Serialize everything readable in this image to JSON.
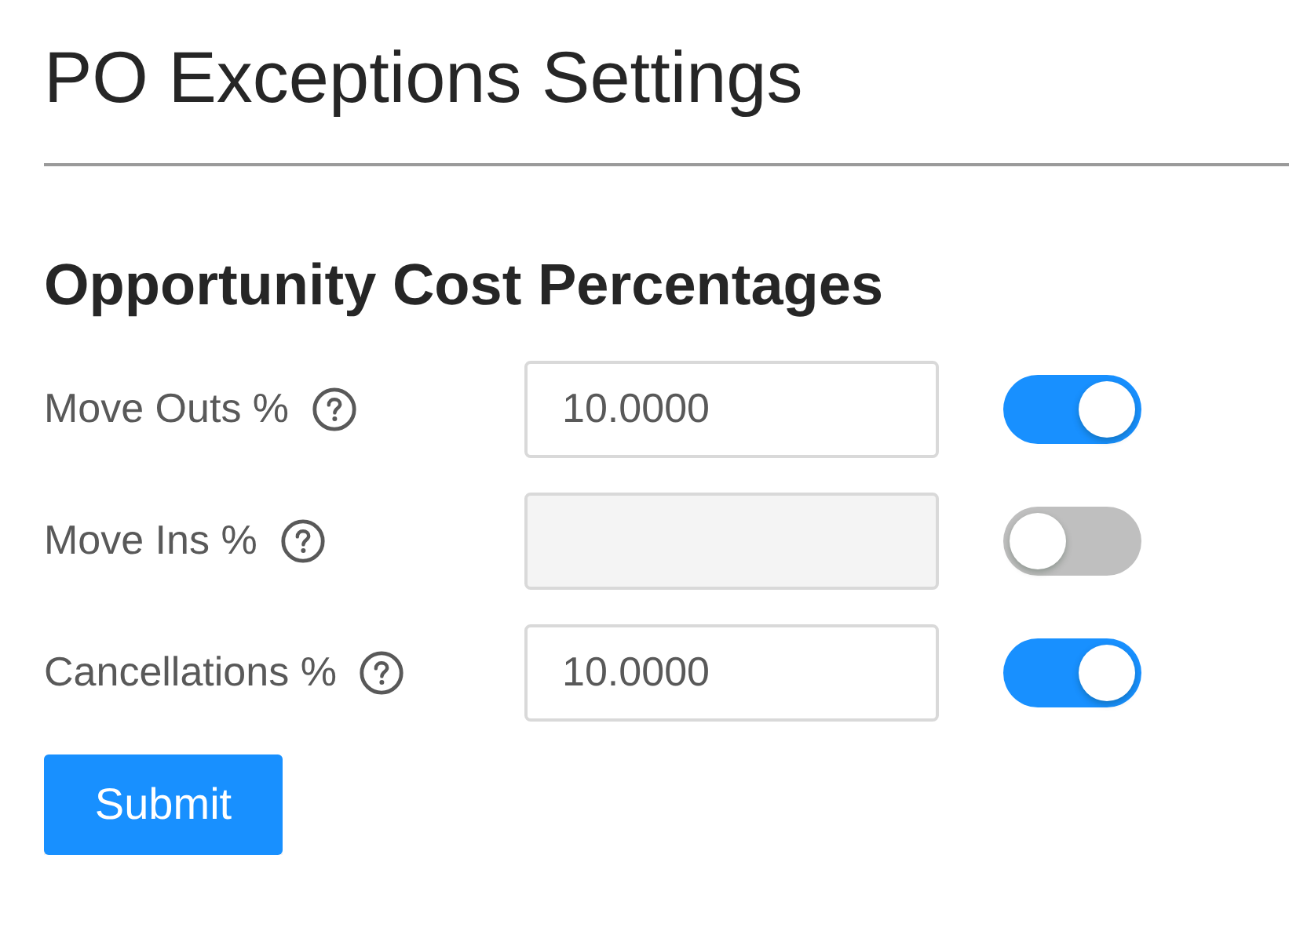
{
  "page": {
    "title": "PO Exceptions Settings"
  },
  "section": {
    "title": "Opportunity Cost Percentages"
  },
  "rows": [
    {
      "label": "Move Outs %",
      "value": "10.0000",
      "on": true
    },
    {
      "label": "Move Ins %",
      "on": false
    },
    {
      "label": "Cancellations %",
      "value": "10.0000",
      "on": true
    }
  ],
  "submit_button": {
    "label": "Submit"
  }
}
